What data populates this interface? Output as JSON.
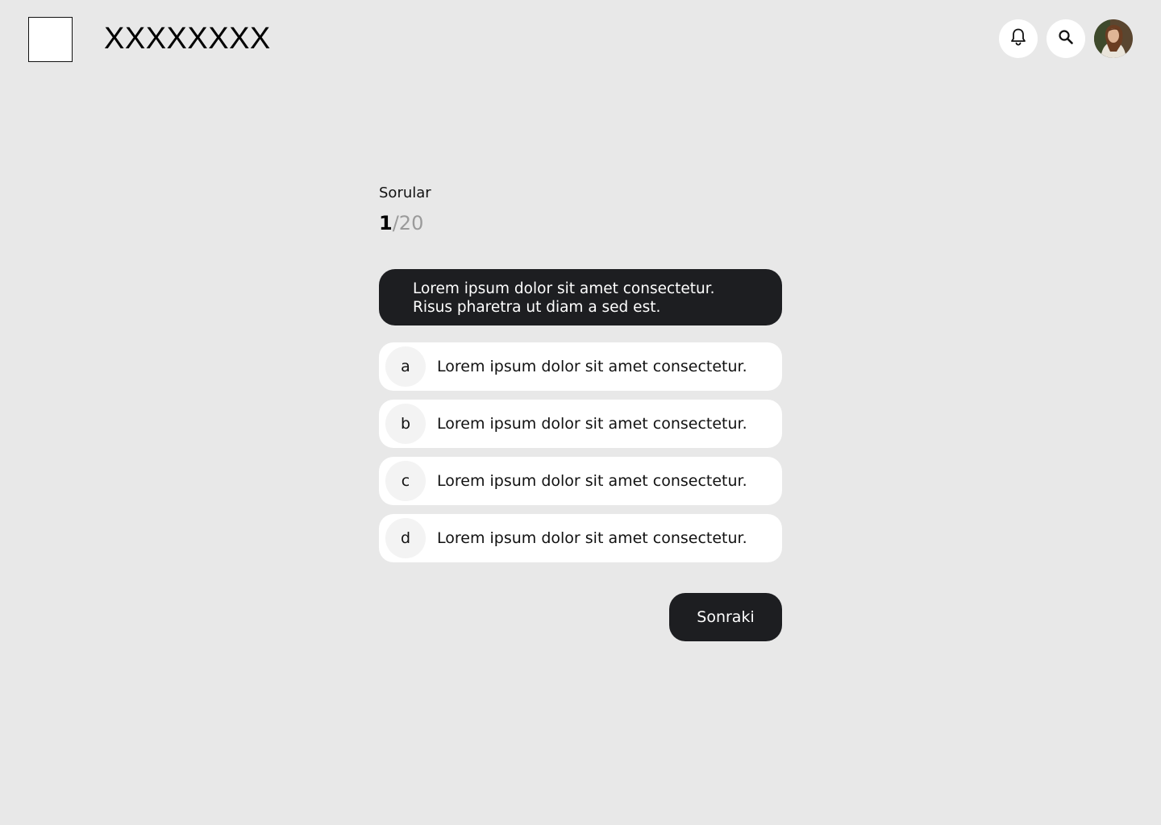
{
  "header": {
    "title": "XXXXXXXX",
    "icons": [
      "bell-icon",
      "search-icon"
    ]
  },
  "quiz": {
    "section_label": "Sorular",
    "counter": {
      "current": "1",
      "separator": "/",
      "total": "20"
    },
    "question": "Lorem ipsum dolor sit amet consectetur. Risus pharetra ut diam a sed est.",
    "options": [
      {
        "letter": "a",
        "text": "Lorem ipsum dolor sit amet consectetur."
      },
      {
        "letter": "b",
        "text": "Lorem ipsum dolor sit amet consectetur."
      },
      {
        "letter": "c",
        "text": "Lorem ipsum dolor sit amet consectetur."
      },
      {
        "letter": "d",
        "text": "Lorem ipsum dolor sit amet consectetur."
      }
    ],
    "next_label": "Sonraki"
  },
  "colors": {
    "background": "#e8e8e8",
    "dark": "#1d1e21",
    "card": "#ffffff",
    "muted": "#9a9a9a"
  }
}
